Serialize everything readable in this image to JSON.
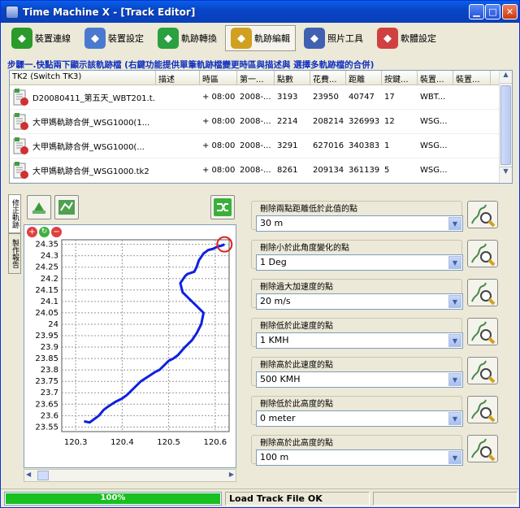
{
  "window": {
    "title": "Time Machine X - [Track Editor]"
  },
  "toolbar": {
    "items": [
      {
        "label": "裝置連線",
        "icon": "device-connect-icon",
        "color": "#2a9a2a"
      },
      {
        "label": "裝置設定",
        "icon": "device-settings-icon",
        "color": "#4a7ad0"
      },
      {
        "label": "軌跡轉換",
        "icon": "track-convert-icon",
        "color": "#2aa040"
      },
      {
        "label": "軌跡編輯",
        "icon": "track-edit-icon",
        "color": "#d0a020"
      },
      {
        "label": "照片工具",
        "icon": "photo-tool-icon",
        "color": "#4060b0"
      },
      {
        "label": "軟體設定",
        "icon": "software-settings-icon",
        "color": "#d04040"
      }
    ],
    "active": 3
  },
  "step_text": "步驟一.快點兩下顯示該軌跡檔 (右鍵功能提供單筆軌跡檔變更時區與描述與 選擇多軌跡檔的合併)",
  "table": {
    "columns": [
      "TK2 (Switch TK3)",
      "描述",
      "時區",
      "第一...",
      "點數",
      "花費...",
      "距離",
      "按鍵...",
      "裝置...",
      "裝置..."
    ],
    "rows": [
      [
        "D20080411_第五天_WBT201.t...",
        "",
        "+ 08:00",
        "2008-...",
        "3193",
        "23950",
        "40747",
        "17",
        "WBT...",
        ""
      ],
      [
        "大甲媽軌跡合併_WSG1000(1...",
        "",
        "+ 08:00",
        "2008-...",
        "2214",
        "208214",
        "326993",
        "12",
        "WSG...",
        ""
      ],
      [
        "大甲媽軌跡合併_WSG1000(...",
        "",
        "+ 08:00",
        "2008-...",
        "3291",
        "627016",
        "340383",
        "1",
        "WSG...",
        ""
      ],
      [
        "大甲媽軌跡合併_WSG1000.tk2",
        "",
        "+ 08:00",
        "2008-...",
        "8261",
        "209134",
        "361139",
        "5",
        "WSG...",
        ""
      ]
    ]
  },
  "side_tabs": [
    "修正軌跡",
    "製作報告"
  ],
  "chart_data": {
    "type": "line",
    "xlim": [
      120.27,
      120.63
    ],
    "ylim": [
      23.53,
      24.37
    ],
    "x_ticks": [
      "120.3",
      "120.4",
      "120.5",
      "120.6"
    ],
    "y_ticks": [
      "24.35",
      "24.3",
      "24.25",
      "24.2",
      "24.15",
      "24.1",
      "24.05",
      "24",
      "23.95",
      "23.9",
      "23.85",
      "23.8",
      "23.75",
      "23.7",
      "23.65",
      "23.6",
      "23.55"
    ],
    "grid": true,
    "color": "#1020e0",
    "x": [
      120.318,
      120.33,
      120.35,
      120.36,
      120.37,
      120.385,
      120.4,
      120.41,
      120.42,
      120.43,
      120.44,
      120.455,
      120.47,
      120.48,
      120.49,
      120.5,
      120.51,
      120.52,
      120.535,
      120.55,
      120.56,
      120.57,
      120.575,
      120.56,
      120.545,
      120.53,
      120.525,
      120.535,
      120.54,
      120.555,
      120.56,
      120.565,
      120.575,
      120.585,
      120.595,
      120.605,
      120.615,
      120.62
    ],
    "y": [
      23.575,
      23.57,
      23.6,
      23.625,
      23.64,
      23.66,
      23.675,
      23.69,
      23.71,
      23.73,
      23.75,
      23.77,
      23.79,
      23.8,
      23.82,
      23.84,
      23.85,
      23.865,
      23.9,
      23.93,
      23.96,
      24.0,
      24.05,
      24.08,
      24.11,
      24.14,
      24.18,
      24.21,
      24.22,
      24.23,
      24.25,
      24.28,
      24.31,
      24.325,
      24.33,
      24.34,
      24.345,
      24.35
    ]
  },
  "filters": [
    {
      "label": "刪除兩點距離低於此值的點",
      "value": "30 m"
    },
    {
      "label": "刪除小於此角度變化的點",
      "value": "1 Deg"
    },
    {
      "label": "刪除過大加速度的點",
      "value": "20 m/s"
    },
    {
      "label": "刪除低於此速度的點",
      "value": "1 KMH"
    },
    {
      "label": "刪除高於此速度的點",
      "value": "500 KMH"
    },
    {
      "label": "刪除低於此高度的點",
      "value": "0 meter"
    },
    {
      "label": "刪除高於此高度的點",
      "value": "100 m"
    }
  ],
  "status": {
    "progress_text": "100%",
    "progress": 1.0,
    "message": "Load Track File OK"
  }
}
